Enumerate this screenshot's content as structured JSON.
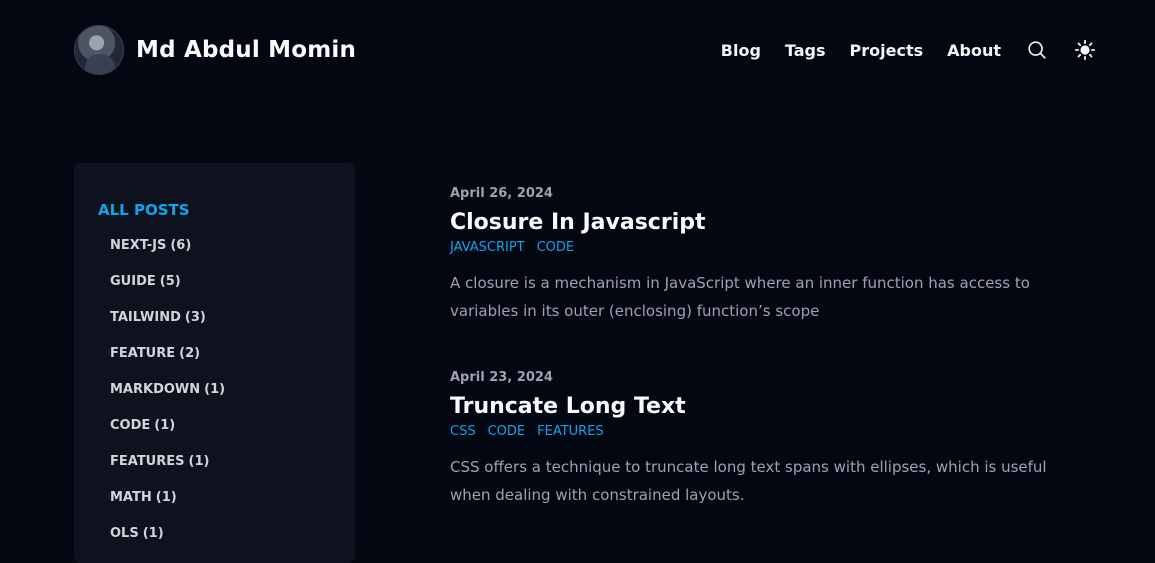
{
  "header": {
    "site_title": "Md Abdul Momin",
    "nav": [
      "Blog",
      "Tags",
      "Projects",
      "About"
    ]
  },
  "sidebar": {
    "all_posts": "ALL POSTS",
    "tags": [
      {
        "name": "NEXT-JS",
        "count": "(6)"
      },
      {
        "name": "GUIDE",
        "count": "(5)"
      },
      {
        "name": "TAILWIND",
        "count": "(3)"
      },
      {
        "name": "FEATURE",
        "count": "(2)"
      },
      {
        "name": "MARKDOWN",
        "count": "(1)"
      },
      {
        "name": "CODE",
        "count": "(1)"
      },
      {
        "name": "FEATURES",
        "count": "(1)"
      },
      {
        "name": "MATH",
        "count": "(1)"
      },
      {
        "name": "OLS",
        "count": "(1)"
      }
    ]
  },
  "posts": [
    {
      "date": "April 26, 2024",
      "title": "Closure In Javascript",
      "tags": [
        "JAVASCRIPT",
        "CODE"
      ],
      "summary": "A closure is a mechanism in JavaScript where an inner function has access to variables in its outer (enclosing) function’s scope"
    },
    {
      "date": "April 23, 2024",
      "title": "Truncate Long Text",
      "tags": [
        "CSS",
        "CODE",
        "FEATURES"
      ],
      "summary": "CSS offers a technique to truncate long text spans with ellipses, which is useful when dealing with constrained layouts."
    }
  ],
  "colors": {
    "accent": "#0ea5e9",
    "background": "#030712",
    "panel": "#0d121e"
  }
}
